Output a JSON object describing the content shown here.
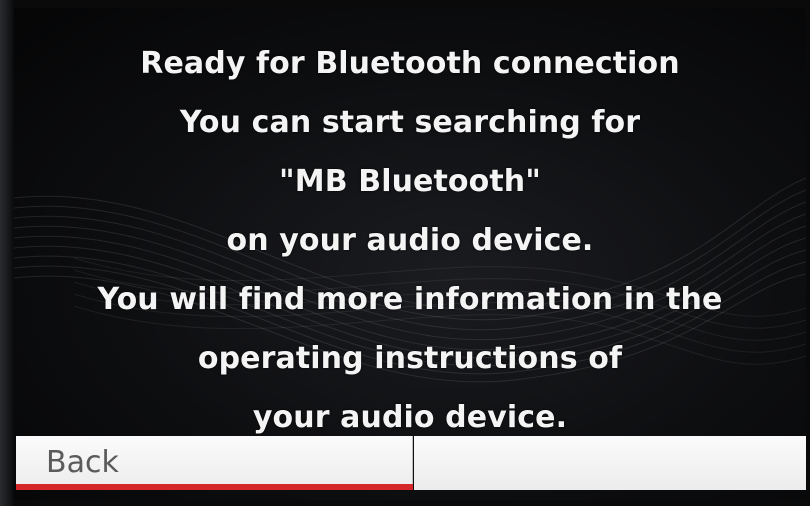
{
  "dialog": {
    "lines": [
      "Ready for Bluetooth connection",
      "You can start searching for",
      "\"MB Bluetooth\"",
      "on your audio device.",
      "You will find more information in the",
      "operating instructions of",
      "your audio device."
    ]
  },
  "softkeys": {
    "left_label": "Back",
    "right_label": ""
  },
  "colors": {
    "background": "#0d0e10",
    "text": "#f4f4f4",
    "softkey_bg": "#f5f5f5",
    "softkey_text": "#5b5b5b",
    "focus_accent": "#d5262a"
  }
}
